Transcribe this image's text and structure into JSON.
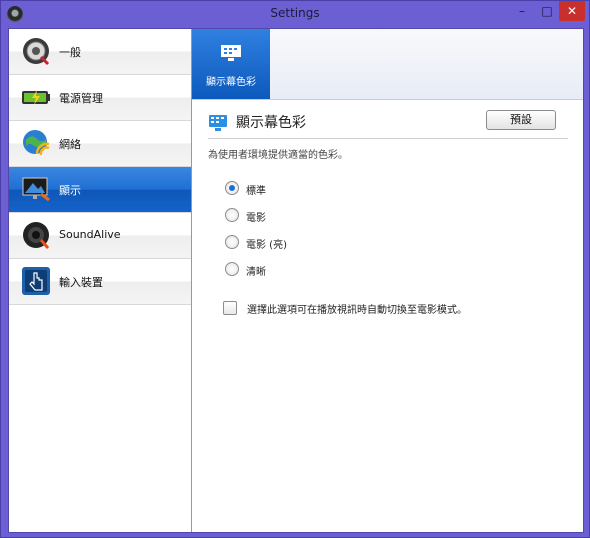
{
  "window": {
    "title": "Settings",
    "minimize": "–",
    "maximize": "□",
    "close": "✕"
  },
  "sidebar": {
    "items": [
      {
        "label": "一般",
        "icon": "gear-icon"
      },
      {
        "label": "電源管理",
        "icon": "battery-icon"
      },
      {
        "label": "網絡",
        "icon": "wifi-globe-icon"
      },
      {
        "label": "顯示",
        "icon": "monitor-icon"
      },
      {
        "label": "SoundAlive",
        "icon": "speaker-icon"
      },
      {
        "label": "輸入裝置",
        "icon": "touch-hand-icon"
      }
    ],
    "selected_index": 3
  },
  "tab": {
    "label": "顯示幕色彩",
    "icon": "display-color-icon"
  },
  "section": {
    "title": "顯示幕色彩",
    "default_button": "預設",
    "description": "為使用者環境提供適當的色彩。",
    "options": [
      "標準",
      "電影",
      "電影 (亮)",
      "清晰"
    ],
    "selected_option": 0,
    "checkbox_label": "選擇此選項可在播放視訊時自動切換至電影模式。",
    "checkbox_checked": false
  },
  "colors": {
    "accent": "#1f6fd4",
    "titlebar": "#6c5fd3",
    "close": "#c7302c"
  }
}
